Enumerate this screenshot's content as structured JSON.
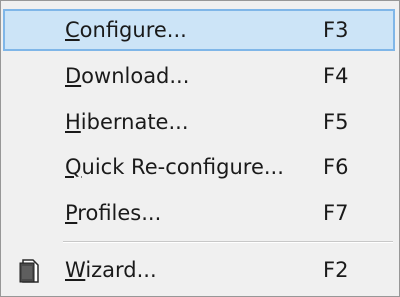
{
  "menu": {
    "items": [
      {
        "first": "C",
        "rest": "onfigure...",
        "shortcut": "F3"
      },
      {
        "first": "D",
        "rest": "ownload...",
        "shortcut": "F4"
      },
      {
        "first": "H",
        "rest": "ibernate...",
        "shortcut": "F5"
      },
      {
        "first": "Q",
        "rest": "uick Re-configure...",
        "shortcut": "F6"
      },
      {
        "first": "P",
        "rest": "rofiles...",
        "shortcut": "F7"
      },
      {
        "first": "W",
        "rest": "izard...",
        "shortcut": "F2",
        "icon": "wizard-document-icon"
      }
    ],
    "selected_index": 0,
    "colors": {
      "selected_bg": "#cce4f7",
      "selected_border": "#7fb6e8",
      "menu_bg": "#f0f0f0",
      "text": "#1a1a1a"
    }
  }
}
